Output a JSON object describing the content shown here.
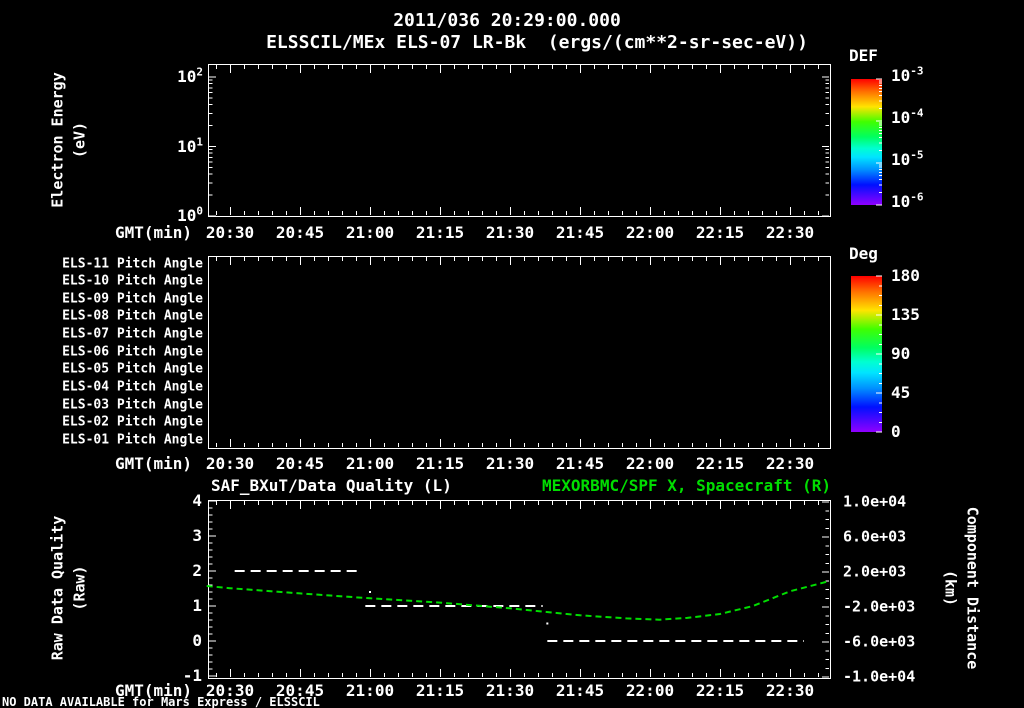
{
  "header": {
    "title_line1": "2011/036 20:29:00.000",
    "title_line2": "ELSSCIL/MEx ELS-07 LR-Bk  (ergs/(cm**2-sr-sec-eV))"
  },
  "colors": {
    "background": "#000000",
    "foreground": "#ffffff",
    "plot_green": "#00dd00"
  },
  "time_axis": {
    "label": "GMT(min)",
    "ticks": [
      "20:30",
      "20:45",
      "21:00",
      "21:15",
      "21:30",
      "21:45",
      "22:00",
      "22:15",
      "22:30"
    ]
  },
  "footer": {
    "no_data_text": "NO DATA AVAILABLE for Mars Express / ELSSCIL"
  },
  "rainbow_gradient": [
    {
      "offset": 0.0,
      "color": "#ff0000"
    },
    {
      "offset": 0.1,
      "color": "#ff7000"
    },
    {
      "offset": 0.22,
      "color": "#ffe400"
    },
    {
      "offset": 0.34,
      "color": "#40ff00"
    },
    {
      "offset": 0.46,
      "color": "#00ff60"
    },
    {
      "offset": 0.55,
      "color": "#00ffd0"
    },
    {
      "offset": 0.62,
      "color": "#00e4ff"
    },
    {
      "offset": 0.72,
      "color": "#0090ff"
    },
    {
      "offset": 0.84,
      "color": "#0010ff"
    },
    {
      "offset": 1.0,
      "color": "#9000ff"
    }
  ],
  "chart_data": [
    {
      "type": "heatmap",
      "title": "ELSSCIL/MEx ELS-07 LR-Bk",
      "units": "(ergs/(cm**2-sr-sec-eV))",
      "xlabel": "GMT(min)",
      "ylabel": [
        "Electron Energy",
        "(eV)"
      ],
      "y_scale": "log",
      "ylim": [
        1,
        150
      ],
      "xlim": [
        "20:25",
        "22:38"
      ],
      "y_tick_labels": [
        {
          "base": "10",
          "exp": "2"
        },
        {
          "base": "10",
          "exp": "1"
        },
        {
          "base": "10",
          "exp": "0"
        }
      ],
      "values": [],
      "no_data": true,
      "colorbar": {
        "title": "DEF",
        "scale": "log",
        "tick_labels": [
          {
            "base": "10",
            "exp": "-3"
          },
          {
            "base": "10",
            "exp": "-4"
          },
          {
            "base": "10",
            "exp": "-5"
          },
          {
            "base": "10",
            "exp": "-6"
          }
        ]
      }
    },
    {
      "type": "heatmap",
      "xlabel": "GMT(min)",
      "xlim": [
        "20:25",
        "22:38"
      ],
      "rows": [
        "ELS-11 Pitch Angle",
        "ELS-10 Pitch Angle",
        "ELS-09 Pitch Angle",
        "ELS-08 Pitch Angle",
        "ELS-07 Pitch Angle",
        "ELS-06 Pitch Angle",
        "ELS-05 Pitch Angle",
        "ELS-04 Pitch Angle",
        "ELS-03 Pitch Angle",
        "ELS-02 Pitch Angle",
        "ELS-01 Pitch Angle"
      ],
      "values": [],
      "no_data": true,
      "colorbar": {
        "title": "Deg",
        "tick_labels": [
          "180",
          "135",
          "90",
          "45",
          "0"
        ]
      }
    },
    {
      "type": "line",
      "title_left": "SAF_BXuT/Data Quality (L)",
      "title_right": "MEXORBMC/SPF X, Spacecraft (R)",
      "xlabel": "GMT(min)",
      "xlim": [
        "20:25",
        "22:38"
      ],
      "left_axis": {
        "label_lines": [
          "Raw Data Quality",
          "(Raw)"
        ],
        "tick_labels": [
          "4",
          "3",
          "2",
          "1",
          "0",
          "-1"
        ],
        "range": [
          -1,
          4
        ]
      },
      "right_axis": {
        "label_lines": [
          "Component Distance",
          "(km)"
        ],
        "tick_labels": [
          "1.0e+04",
          "6.0e+03",
          "2.0e+03",
          "-2.0e+03",
          "-6.0e+03",
          "-1.0e+04"
        ],
        "range": [
          -10000,
          10000
        ]
      },
      "series": [
        {
          "name": "Data Quality",
          "axis": "left",
          "color": "#ffffff",
          "style": "dashed",
          "segments": [
            {
              "value": 2,
              "start": "20:31",
              "end": "20:58"
            },
            {
              "value": 1,
              "start": "20:59",
              "end": "21:37"
            },
            {
              "value": 0,
              "start": "21:38",
              "end": "22:33"
            }
          ],
          "points": [
            {
              "t": "21:00",
              "value": 1.4
            },
            {
              "t": "21:38",
              "value": 0.5
            }
          ]
        },
        {
          "name": "Spacecraft X",
          "axis": "right",
          "color": "#00dd00",
          "style": "dashed",
          "points": [
            [
              "20:25",
              400
            ],
            [
              "20:30",
              150
            ],
            [
              "20:45",
              -450
            ],
            [
              "21:00",
              -1000
            ],
            [
              "21:15",
              -1500
            ],
            [
              "21:30",
              -2150
            ],
            [
              "21:45",
              -2950
            ],
            [
              "21:55",
              -3300
            ],
            [
              "22:02",
              -3450
            ],
            [
              "22:08",
              -3250
            ],
            [
              "22:15",
              -2800
            ],
            [
              "22:22",
              -1900
            ],
            [
              "22:30",
              -200
            ],
            [
              "22:38",
              900
            ]
          ]
        }
      ]
    }
  ]
}
